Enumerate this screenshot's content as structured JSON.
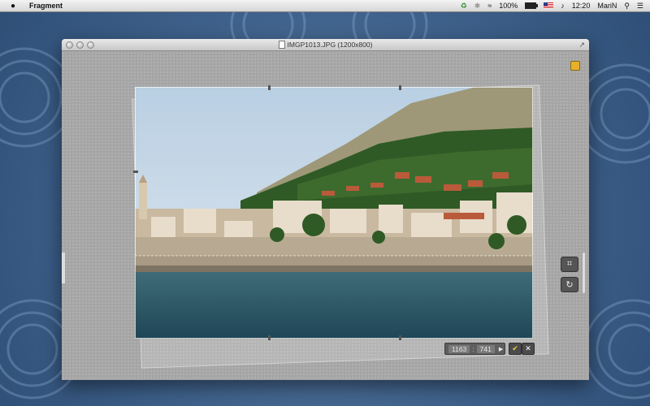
{
  "menubar": {
    "app_name": "Fragment",
    "battery": "100%",
    "time": "12:20",
    "user": "MariN",
    "battery_level": 1.0,
    "icons": [
      "apple-icon",
      "sync-icon",
      "bluetooth-icon",
      "wifi-icon",
      "battery-icon",
      "flag-icon",
      "volume-icon",
      "spotlight-icon",
      "notification-icon"
    ]
  },
  "window": {
    "title": "IMGP1013.JPG (1200x800)"
  },
  "crop": {
    "width": "1163",
    "height": "741",
    "separator": ":"
  },
  "buttons": {
    "ok_glyph": "✔",
    "cancel_glyph": "✕",
    "crop_glyph": "⌗",
    "rotate_glyph": "↻"
  }
}
